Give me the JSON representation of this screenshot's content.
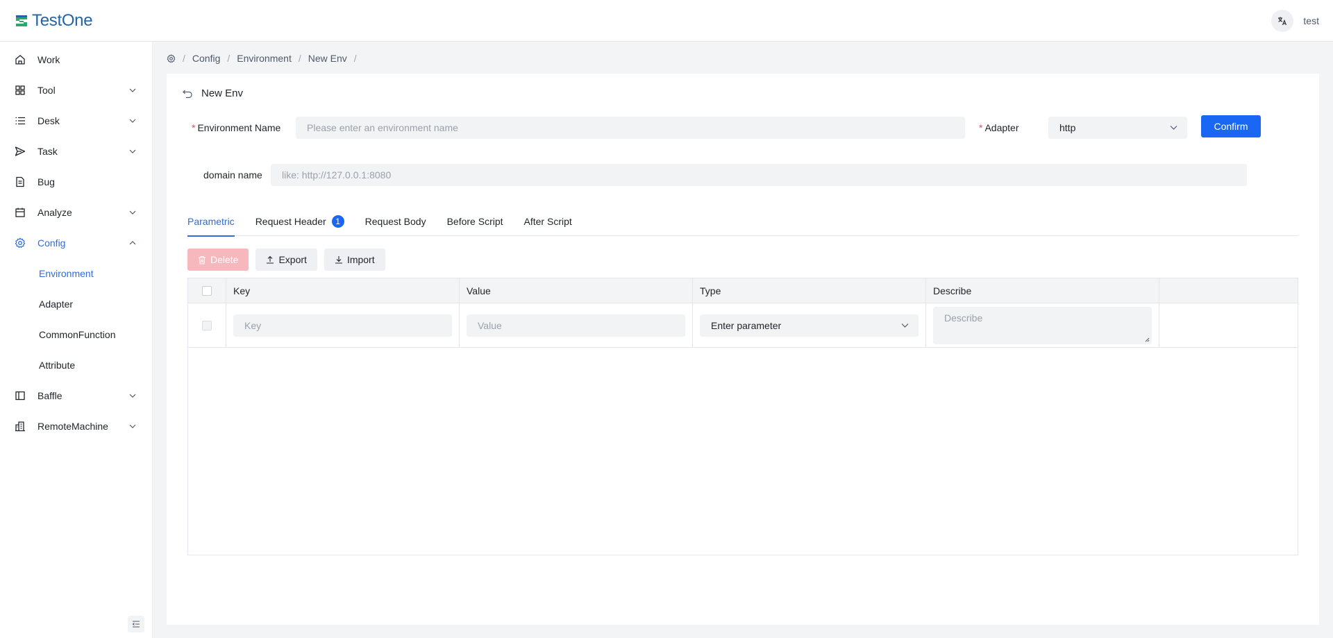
{
  "app": {
    "name": "TestOne",
    "user": "test"
  },
  "sidebar": {
    "items": [
      {
        "label": "Work",
        "icon": "home-icon"
      },
      {
        "label": "Tool",
        "icon": "grid-icon"
      },
      {
        "label": "Desk",
        "icon": "list-icon"
      },
      {
        "label": "Task",
        "icon": "send-icon"
      },
      {
        "label": "Bug",
        "icon": "document-icon"
      },
      {
        "label": "Analyze",
        "icon": "calendar-icon"
      },
      {
        "label": "Config",
        "icon": "gear-icon"
      },
      {
        "label": "Baffle",
        "icon": "sidebar-panel-icon"
      },
      {
        "label": "RemoteMachine",
        "icon": "building-icon"
      }
    ],
    "config_sub": [
      "Environment",
      "Adapter",
      "CommonFunction",
      "Attribute"
    ]
  },
  "breadcrumb": {
    "items": [
      "Config",
      "Environment",
      "New Env"
    ]
  },
  "page": {
    "title": "New Env"
  },
  "form": {
    "env_name_label": "Environment Name",
    "env_name_placeholder": "Please enter an environment name",
    "adapter_label": "Adapter",
    "adapter_value": "http",
    "confirm_label": "Confirm",
    "domain_label": "domain name",
    "domain_placeholder": "like: http://127.0.0.1:8080"
  },
  "tabs": [
    {
      "label": "Parametric"
    },
    {
      "label": "Request Header",
      "badge": "1"
    },
    {
      "label": "Request Body"
    },
    {
      "label": "Before Script"
    },
    {
      "label": "After Script"
    }
  ],
  "toolbar": {
    "delete_label": "Delete",
    "export_label": "Export",
    "import_label": "Import"
  },
  "table": {
    "columns": [
      "Key",
      "Value",
      "Type",
      "Describe"
    ],
    "row": {
      "key_placeholder": "Key",
      "value_placeholder": "Value",
      "type_value": "Enter parameter",
      "describe_placeholder": "Describe"
    }
  },
  "colors": {
    "primary": "#1967f2",
    "active": "#2f6bdc",
    "danger_disabled": "#f7b8bd"
  }
}
